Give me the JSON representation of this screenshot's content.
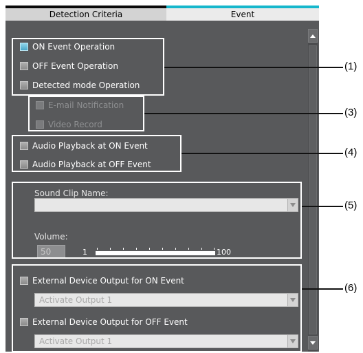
{
  "tabs": [
    {
      "label": "Detection Criteria",
      "active": false
    },
    {
      "label": "Event",
      "active": true
    }
  ],
  "event_ops": [
    {
      "label": "ON Event Operation",
      "checked": true
    },
    {
      "label": "OFF Event Operation",
      "checked": false
    },
    {
      "label": "Detected mode Operation",
      "checked": false
    }
  ],
  "notify": [
    {
      "label": "E-mail Notification",
      "enabled": false
    },
    {
      "label": "Video Record",
      "enabled": false
    }
  ],
  "audio": [
    {
      "label": "Audio Playback at ON Event",
      "checked": false
    },
    {
      "label": "Audio Playback at OFF Event",
      "checked": false
    }
  ],
  "sound": {
    "label": "Sound Clip Name:",
    "value": "",
    "volume_label": "Volume:",
    "volume_value": "50",
    "slider_min": "1",
    "slider_max": "100"
  },
  "external": {
    "on_label": "External Device Output for ON Event",
    "on_value": "Activate Output 1",
    "off_label": "External Device Output for OFF Event",
    "off_value": "Activate Output 1"
  },
  "callouts": [
    "(1)",
    "(3)",
    "(4)",
    "(5)",
    "(6)"
  ],
  "colors": {
    "active_tab_accent": "#16b7cc",
    "panel_bg": "#58595b",
    "checked_box": "#4aa6c6"
  }
}
